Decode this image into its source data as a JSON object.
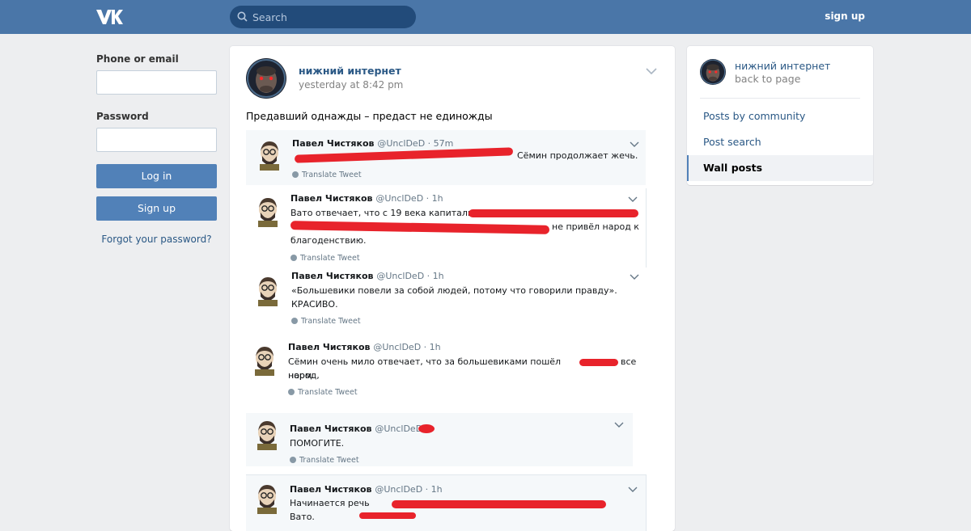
{
  "header": {
    "logo_icon": "vk-logo-icon",
    "search_placeholder": "Search",
    "signup_label": "sign up"
  },
  "login": {
    "phone_label": "Phone or email",
    "password_label": "Password",
    "login_button": "Log in",
    "signup_button": "Sign up",
    "forgot_link": "Forgot your password?"
  },
  "post": {
    "author": "нижний интернет",
    "date": "yesterday at 8:42 pm",
    "text": "Предавший однажды – предаст не единожды",
    "tweets": [
      {
        "name": "Павел Чистяков",
        "meta": "@UnclDeD · 57m",
        "text": "Сёмин продолжает жечь.",
        "translate": "Translate Tweet"
      },
      {
        "name": "Павел Чистяков",
        "meta": "@UnclDeD · 1h",
        "text": "Вато отвечает, что с 19 века капитализм",
        "text2": "не привёл народ к",
        "text3": "благоденствию.",
        "translate": "Translate Tweet"
      },
      {
        "name": "Павел Чистяков",
        "meta": "@UnclDeD · 1h",
        "text": "«Большевики повели за собой людей, потому что говорили правду».",
        "text2": "КРАСИВО.",
        "translate": "Translate Tweet"
      },
      {
        "name": "Павел Чистяков",
        "meta": "@UnclDeD · 1h",
        "text": "Сёмин очень мило отвечает, что за большевиками пошёл народ,",
        "text_tail": "все",
        "text2": "норм.",
        "translate": "Translate Tweet"
      },
      {
        "name": "Павел Чистяков",
        "meta": "@UnclDeD",
        "text": "ПОМОГИТЕ.",
        "translate": "Translate Tweet"
      },
      {
        "name": "Павел Чистяков",
        "meta": "@UnclDeD · 1h",
        "text": "Начинается речь Вато."
      }
    ]
  },
  "sidebar": {
    "community_name": "нижний интернет",
    "back_label": "back to page",
    "items": [
      {
        "label": "Posts by community"
      },
      {
        "label": "Post search"
      },
      {
        "label": "Wall posts"
      }
    ]
  },
  "colors": {
    "header_bg": "#4a76a8",
    "button_bg": "#5181b8",
    "link": "#2a5885",
    "redaction": "#e8232b"
  }
}
